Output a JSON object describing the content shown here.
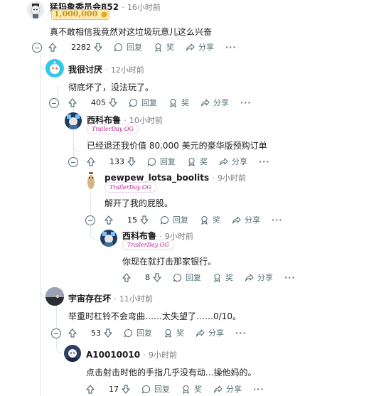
{
  "comments": [
    {
      "user": "猛犸象委员会852",
      "time": "16小时前",
      "badge": "1,000,000",
      "text": "真不敢相信我竟然对这垃圾玩意儿这么兴奋",
      "score": "2282"
    },
    {
      "user": "我很讨厌",
      "time": "12小时前",
      "text": "彻底坏了，没法玩了。",
      "score": "405"
    },
    {
      "user": "西科布鲁",
      "time": "10小时前",
      "flair": "TrailerDay OG",
      "text": "已经退还我价值 80.000 美元的豪华版预购订单",
      "score": "133"
    },
    {
      "user": "pewpew_lotsa_boolits",
      "time": "9小时前",
      "flair": "TrailerDay OG",
      "text": "解开了我的屁股。",
      "score": "15"
    },
    {
      "user": "西科布鲁",
      "time": "9小时前",
      "flair": "TrailerDay OG",
      "text": "你现在就打击那家银行。",
      "score": "8"
    },
    {
      "user": "宇宙存在坏",
      "time": "11小时前",
      "text": "举重时杠铃不会弯曲……太失望了……0/10。",
      "score": "53"
    },
    {
      "user": "A10010010",
      "time": "9小时前",
      "text": "点击射击时他的手指几乎没有动...操他妈的。",
      "score": "17"
    }
  ],
  "labels": {
    "reply": "回复",
    "award": "奖",
    "share": "分享",
    "more": "···",
    "sep": "·"
  },
  "icons": [
    "upvote-icon",
    "downvote-icon",
    "reply-bubble-icon",
    "award-icon",
    "share-icon",
    "more-icon",
    "collapse-icon"
  ]
}
